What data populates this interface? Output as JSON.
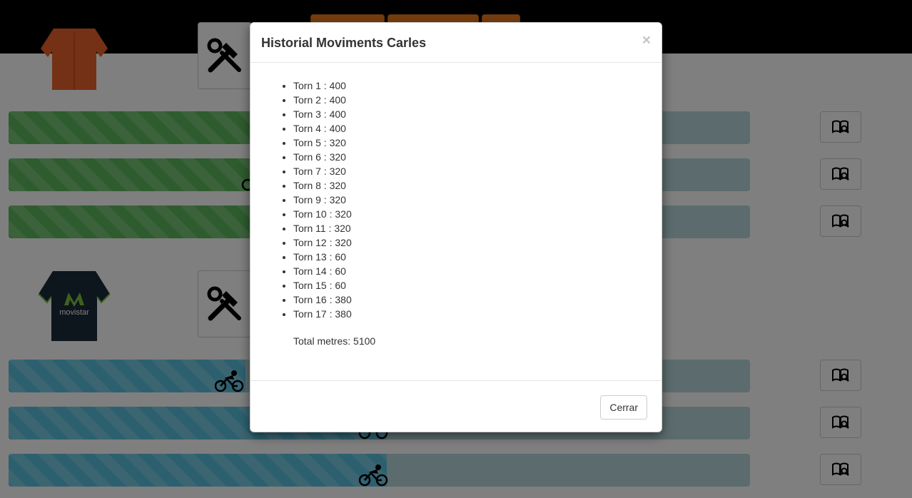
{
  "modal": {
    "title": "Historial Moviments Carles",
    "close_symbol": "×",
    "moves": [
      "Torn 1 : 400",
      "Torn 2 : 400",
      "Torn 3 : 400",
      "Torn 4 : 400",
      "Torn 5 : 320",
      "Torn 6 : 320",
      "Torn 7 : 320",
      "Torn 8 : 320",
      "Torn 9 : 320",
      "Torn 10 : 320",
      "Torn 11 : 320",
      "Torn 12 : 320",
      "Torn 13 : 60",
      "Torn 14 : 60",
      "Torn 15 : 60",
      "Torn 16 : 380",
      "Torn 17 : 380"
    ],
    "total_label": "Total metres: 5100",
    "close_button_label": "Cerrar"
  },
  "teams": [
    {
      "jersey": "orange-jersey",
      "tool_icon": "tools-icon",
      "color": "#5cb85c",
      "riders": [
        {
          "progress_pct": 33,
          "icon": "bicycle-icon"
        },
        {
          "progress_pct": 33,
          "icon": "bicycle-icon"
        },
        {
          "progress_pct": 33,
          "icon": "bicycle-icon"
        }
      ]
    },
    {
      "jersey": "movistar-jersey",
      "jersey_text": "movistar",
      "tool_icon": "tools-icon",
      "color": "#5bc0de",
      "riders": [
        {
          "progress_pct": 32,
          "icon": "bicycle-icon"
        },
        {
          "progress_pct": 51,
          "icon": "bicycle-icon"
        },
        {
          "progress_pct": 51,
          "icon": "bicycle-icon"
        }
      ]
    }
  ],
  "history_button_icon": "book-search-icon",
  "colors": {
    "navbar": "#000000",
    "nav_accent": "#ee7d1f",
    "track": "#b8d9dc",
    "orange_jersey": "#e8632b",
    "movistar_jersey": "#1b2a3a",
    "movistar_logo": "#7fc241"
  }
}
